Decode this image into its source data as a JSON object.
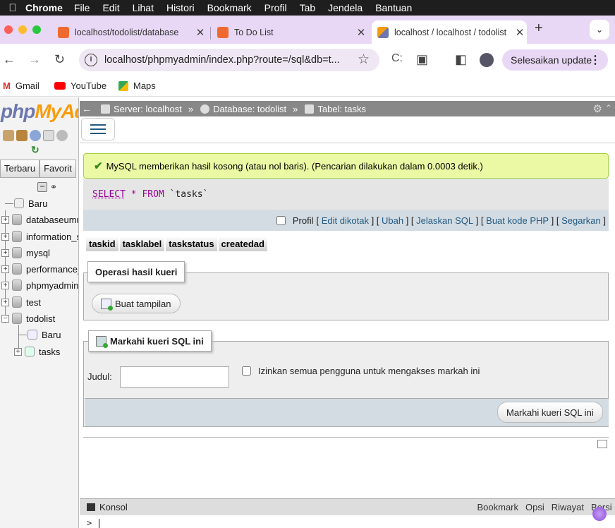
{
  "menubar": {
    "app": "Chrome",
    "items": [
      "File",
      "Edit",
      "Lihat",
      "Histori",
      "Bookmark",
      "Profil",
      "Tab",
      "Jendela",
      "Bantuan"
    ]
  },
  "tabs": [
    {
      "title": "localhost/todolist/database",
      "active": false
    },
    {
      "title": "To Do List",
      "active": false
    },
    {
      "title": "localhost / localhost / todolist",
      "active": true
    }
  ],
  "toolbar": {
    "url": "localhost/phpmyadmin/index.php?route=/sql&db=t...",
    "update_label": "Selesaikan update"
  },
  "bookmarks": [
    "Gmail",
    "YouTube",
    "Maps"
  ],
  "nav": {
    "logo_php": "php",
    "logo_my": "MyAdmin",
    "tabs": [
      "Terbaru",
      "Favorit"
    ],
    "tree": [
      {
        "label": "Baru",
        "level": 0,
        "expander": ""
      },
      {
        "label": "databaseumum",
        "level": 0,
        "expander": "+"
      },
      {
        "label": "information_schema",
        "level": 0,
        "expander": "+"
      },
      {
        "label": "mysql",
        "level": 0,
        "expander": "+"
      },
      {
        "label": "performance_schema",
        "level": 0,
        "expander": "+"
      },
      {
        "label": "phpmyadmin",
        "level": 0,
        "expander": "+"
      },
      {
        "label": "test",
        "level": 0,
        "expander": "+"
      },
      {
        "label": "todolist",
        "level": 0,
        "expander": "−"
      },
      {
        "label": "Baru",
        "level": 1,
        "expander": ""
      },
      {
        "label": "tasks",
        "level": 1,
        "expander": "+"
      }
    ]
  },
  "breadcrumb": {
    "server": "Server: localhost",
    "database": "Database: todolist",
    "table": "Tabel: tasks",
    "separator": "»"
  },
  "result": {
    "message": "MySQL memberikan hasil kosong (atau nol baris). (Pencarian dilakukan dalam 0.0003 detik.)",
    "sql_select": "SELECT",
    "sql_star": "*",
    "sql_from": "FROM",
    "sql_table": "`tasks`",
    "profil_label": "Profil",
    "links": [
      "Edit dikotak",
      "Ubah",
      "Jelaskan SQL",
      "Buat kode PHP",
      "Segarkan"
    ],
    "columns": [
      "taskid",
      "tasklabel",
      "taskstatus",
      "createdad"
    ]
  },
  "operations": {
    "legend": "Operasi hasil kueri",
    "create_view": "Buat tampilan"
  },
  "bookmark_form": {
    "legend": "Markahi kueri SQL ini",
    "title_label": "Judul:",
    "title_value": "",
    "allow_all_label": "Izinkan semua pengguna untuk mengakses markah ini",
    "submit_label": "Markahi kueri SQL ini"
  },
  "console": {
    "label": "Konsol",
    "actions": [
      "Bookmark",
      "Opsi",
      "Riwayat",
      "Bersihkan"
    ],
    "prompt": ">"
  },
  "colors": {
    "tabstrip": "#e9d8f5",
    "success_bg": "#ebf8a4",
    "link": "#235a81",
    "breadbar": "#888888"
  }
}
